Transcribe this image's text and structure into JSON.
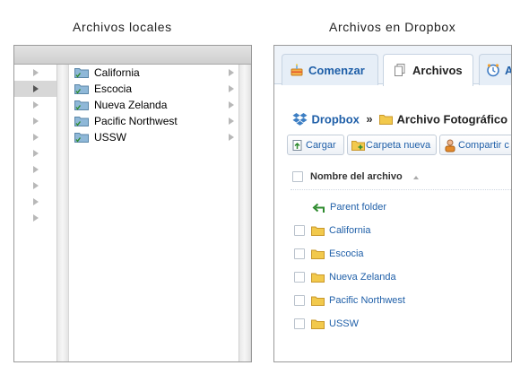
{
  "captions": {
    "left": "Archivos locales",
    "right": "Archivos en Dropbox"
  },
  "finder": {
    "folders": [
      "California",
      "Escocia",
      "Nueva Zelanda",
      "Pacific Northwest",
      "USSW"
    ],
    "selected_index": 1,
    "left_arrow_count": 10
  },
  "dropbox": {
    "tabs": [
      {
        "label": "Comenzar",
        "active": false
      },
      {
        "label": "Archivos",
        "active": true
      },
      {
        "label": "A",
        "active": false
      }
    ],
    "breadcrumb": {
      "root": "Dropbox",
      "separator": "»",
      "current": "Archivo Fotográfico"
    },
    "actions": {
      "upload": "Cargar",
      "new_folder": "Carpeta nueva",
      "share": "Compartir c"
    },
    "column_header": "Nombre del archivo",
    "parent_folder": "Parent folder",
    "rows": [
      "California",
      "Escocia",
      "Nueva Zelanda",
      "Pacific Northwest",
      "USSW"
    ]
  },
  "colors": {
    "link": "#1f5fa8",
    "finder_folder": "#8fb8d8",
    "dropbox_folder": "#f2c94c"
  }
}
